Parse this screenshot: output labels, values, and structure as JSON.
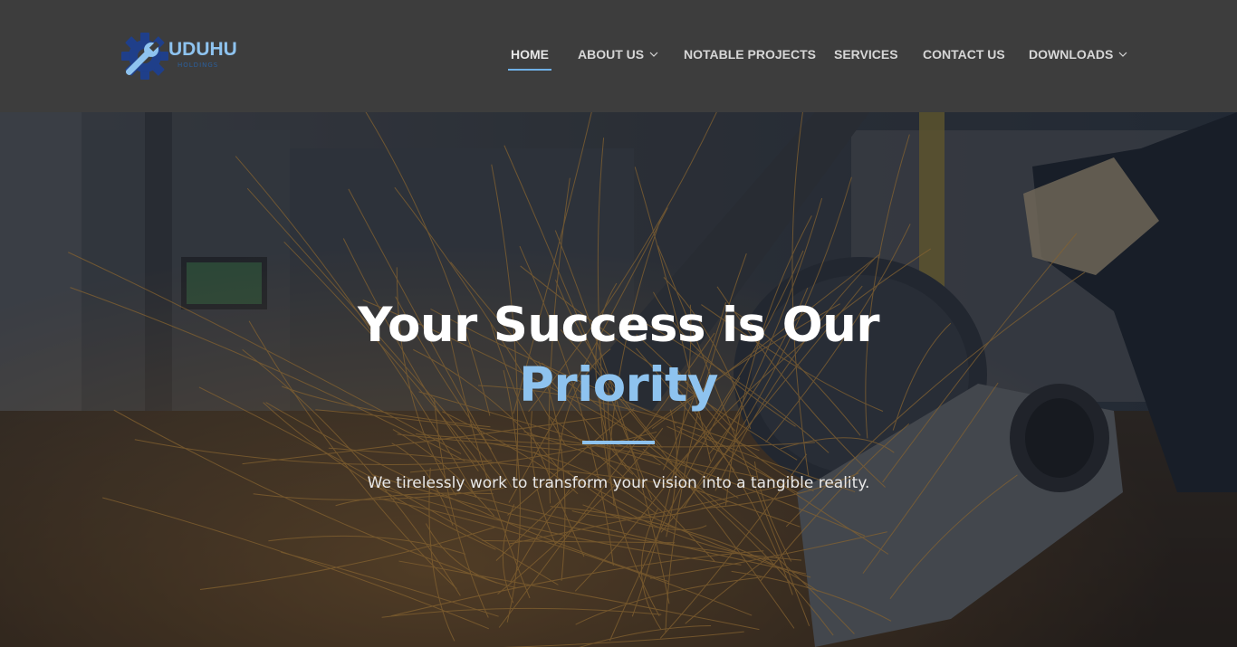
{
  "brand": {
    "name": "UDUHU",
    "tagline": "HOLDINGS",
    "icon": "gear-wrench-icon",
    "colors": {
      "primary": "#8ec3ef",
      "dark": "#2c5f9c"
    }
  },
  "nav": {
    "items": [
      {
        "label": "HOME",
        "active": true,
        "dropdown": false
      },
      {
        "label": "ABOUT US",
        "active": false,
        "dropdown": true
      },
      {
        "label": "NOTABLE PROJECTS",
        "active": false,
        "dropdown": false
      },
      {
        "label": "SERVICES",
        "active": false,
        "dropdown": false
      },
      {
        "label": "CONTACT US",
        "active": false,
        "dropdown": false
      },
      {
        "label": "DOWNLOADS",
        "active": false,
        "dropdown": true
      }
    ]
  },
  "hero": {
    "title_line1": "Your Success is Our",
    "title_accent": "Priority",
    "subtitle": "We tirelessly work to transform your vision into a tangible reality.",
    "background": "grinder-sparks-photo"
  }
}
